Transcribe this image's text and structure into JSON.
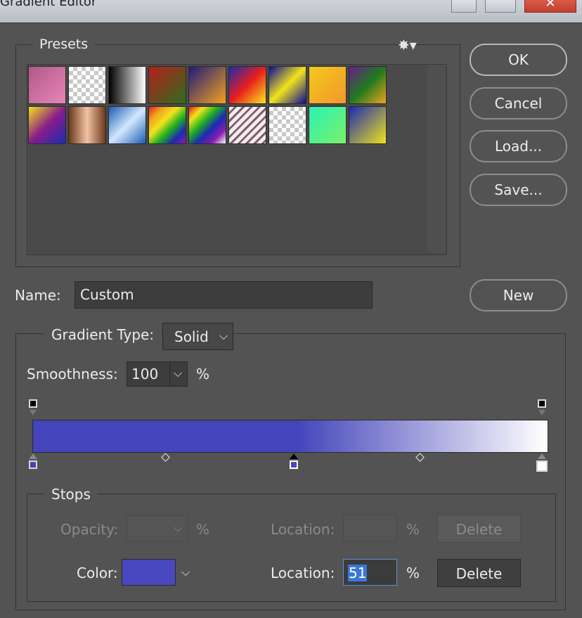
{
  "window": {
    "title": "Gradient Editor"
  },
  "presets": {
    "label": "Presets",
    "gear_icon": "gear-icon",
    "swatches": [
      "linear-gradient(135deg,#b05a86,#e985b8)",
      "checker-brown",
      "linear-gradient(90deg,#000,#fff)",
      "linear-gradient(135deg,#b51e1e,#2f6d1f)",
      "linear-gradient(135deg,#1f1b7a,#f2a21f)",
      "linear-gradient(135deg,#1a2bb2,#e91e1e,#f9e81a)",
      "linear-gradient(135deg,#0a0a9a,#f2e31c,#0a0a9a)",
      "linear-gradient(135deg,#f2c81e,#f2992b)",
      "linear-gradient(135deg,#6a1c8a,#1f7a1f,#f2a21f)",
      "linear-gradient(135deg,#f2e21c,#8a1c8a,#1a2bb2)",
      "linear-gradient(90deg,#6a3a1c,#f2c2a2,#6a3a1c)",
      "linear-gradient(135deg,#1a5bb2,#d2e8ff,#1a5bb2)",
      "linear-gradient(135deg,#e91e1e,#f2a21f,#f2e31c,#1fb21f,#1a2bb2,#8a1cb2)",
      "linear-gradient(135deg,#e91e1e,#f2e31c,#1fb21f,#1a2bb2,#8a1cb2,#fff)",
      "stripes",
      "checker",
      "linear-gradient(135deg,#2bf2b2,#7af26a)",
      "linear-gradient(135deg,#1a2bb2,#f2e31c)"
    ]
  },
  "buttons": {
    "ok": "OK",
    "cancel": "Cancel",
    "load": "Load...",
    "save": "Save...",
    "new": "New"
  },
  "name": {
    "label": "Name:",
    "value": "Custom"
  },
  "gradient": {
    "type_label": "Gradient Type:",
    "type_value": "Solid",
    "smoothness_label": "Smoothness:",
    "smoothness_value": "100",
    "percent": "%",
    "start_color": "#4444bb",
    "end_color": "#ffffff"
  },
  "stops": {
    "label": "Stops",
    "opacity_label": "Opacity:",
    "opacity_value": "",
    "location_label": "Location:",
    "location_value_top": "",
    "delete_label": "Delete",
    "color_label": "Color:",
    "color_value": "#4a48c0",
    "color_location_value": "51"
  }
}
